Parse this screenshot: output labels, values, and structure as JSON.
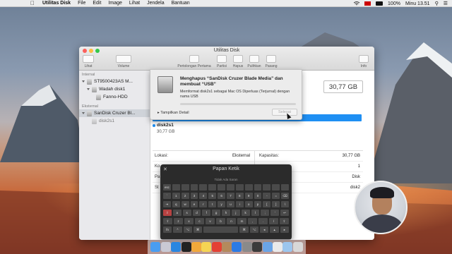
{
  "menubar": {
    "app_name": "Utilitas Disk",
    "items": [
      "File",
      "Edit",
      "Image",
      "Lihat",
      "Jendela",
      "Bantuan"
    ],
    "battery": "100%",
    "clock": "Minu 13.51"
  },
  "window": {
    "title": "Utilitas Disk",
    "toolbar": {
      "view": "Lihat",
      "volume": "Volume",
      "first_aid": "Pertolongan Pertama",
      "partition": "Partisi",
      "erase": "Hapus",
      "restore": "Pulihkan",
      "mount": "Pasang",
      "info": "Info"
    },
    "sidebar": {
      "internal_header": "Internal",
      "external_header": "Eksternal",
      "items": [
        {
          "label": "ST9500423AS M..."
        },
        {
          "label": "Wadah disk1"
        },
        {
          "label": "Fanno-HDD"
        },
        {
          "label": "SanDisk Cruzer Bl..."
        },
        {
          "label": "disk2s1"
        }
      ]
    },
    "main": {
      "capacity_display": "30,77 GB",
      "volume_name": "disk2s1",
      "volume_size": "30,77 GB",
      "usage_fraction": 1.0,
      "info_rows": [
        {
          "k1": "Lokasi:",
          "v1": "Eksternal",
          "k2": "Kapasitas:",
          "v2": "30,77 GB"
        },
        {
          "k1": "Ko",
          "v1": "",
          "k2": "",
          "v2": "1"
        },
        {
          "k1": "Pa",
          "v1": "",
          "k2": "",
          "v2": "Disk"
        },
        {
          "k1": "St",
          "v1": "",
          "k2": "",
          "v2": "disk2"
        }
      ]
    }
  },
  "erase_sheet": {
    "title": "Menghapus “SanDisk Cruzer Blade Media” dan membuat “USB”",
    "description": "Memformat disk2s1 sebagai Mac OS Diperluas (Terjurnal) dengan nama USB",
    "show_details": "Tampilkan Detail",
    "done_button": "Selesai",
    "progress_fraction": 0.0
  },
  "keyboard_viewer": {
    "title": "Papan Ketik",
    "subtitle": "Tidak Ada Saran",
    "rows": [
      [
        "esc",
        "",
        "",
        "",
        "",
        "",
        "",
        "",
        "",
        "",
        "",
        "",
        "",
        ""
      ],
      [
        "`",
        "1",
        "2",
        "3",
        "4",
        "5",
        "6",
        "7",
        "8",
        "9",
        "0",
        "-",
        "=",
        "⌫"
      ],
      [
        "⇥",
        "q",
        "w",
        "e",
        "r",
        "t",
        "y",
        "u",
        "i",
        "o",
        "p",
        "[",
        "]",
        "\\"
      ],
      [
        "⇪",
        "a",
        "s",
        "d",
        "f",
        "g",
        "h",
        "j",
        "k",
        "l",
        ";",
        "'",
        "↩"
      ],
      [
        "⇧",
        "z",
        "x",
        "c",
        "v",
        "b",
        "n",
        "m",
        ",",
        ".",
        "/",
        "⇧"
      ],
      [
        "fn",
        "^",
        "⌥",
        "⌘",
        "",
        "⌘",
        "⌥",
        "◂",
        "▴",
        "▸"
      ]
    ]
  },
  "dock": {
    "apps": [
      "finder",
      "launchpad",
      "safari",
      "terminal",
      "photos",
      "notes",
      "chrome",
      "contacts",
      "appstore",
      "settings",
      "obs",
      "preview",
      "keyboard",
      "finder-window",
      "trash"
    ]
  },
  "colors": {
    "accent": "#1f8ff3",
    "red_light": "#fc605c",
    "yellow_light": "#fdbc40",
    "green_light": "#34c84a"
  }
}
